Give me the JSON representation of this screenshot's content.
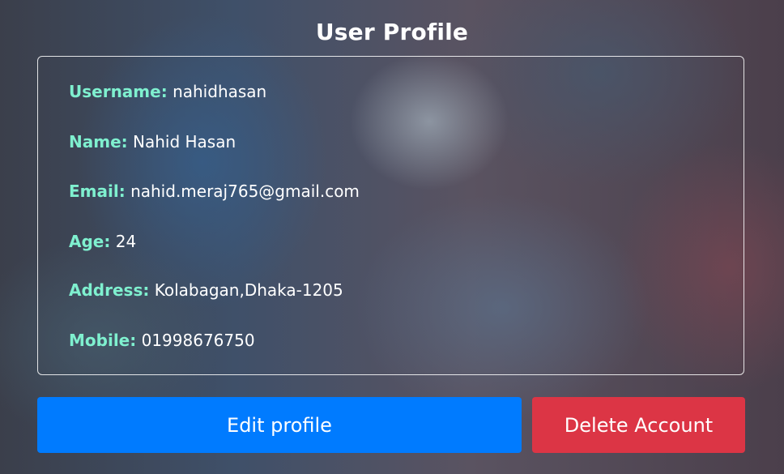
{
  "header": {
    "title": "User Profile"
  },
  "profile": {
    "username": {
      "label": "Username:",
      "value": "nahidhasan"
    },
    "name": {
      "label": "Name:",
      "value": "Nahid Hasan"
    },
    "email": {
      "label": "Email:",
      "value": "nahid.meraj765@gmail.com"
    },
    "age": {
      "label": "Age:",
      "value": "24"
    },
    "address": {
      "label": "Address:",
      "value": "Kolabagan,Dhaka-1205"
    },
    "mobile": {
      "label": "Mobile:",
      "value": "01998676750"
    }
  },
  "actions": {
    "edit_label": "Edit profile",
    "delete_label": "Delete Account"
  },
  "colors": {
    "label_accent": "#7ff0cf",
    "edit_button": "#007bff",
    "delete_button": "#dc3545"
  }
}
